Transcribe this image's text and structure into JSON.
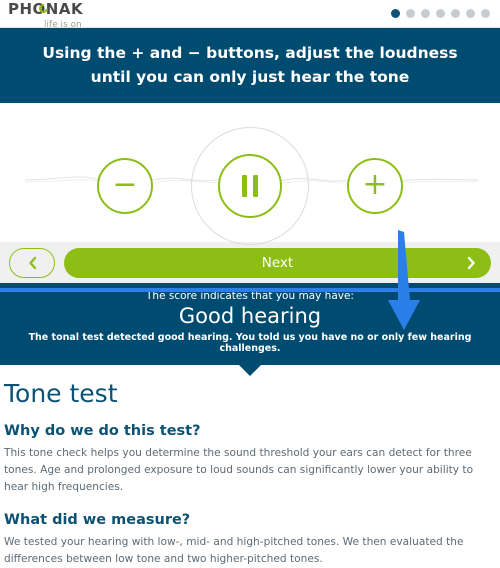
{
  "brand": {
    "name": "PHONAK",
    "tagline": "life is on",
    "logo_icon": "phonak-swoosh-icon",
    "accent_green": "#8CBE16",
    "accent_blue": "#004B70"
  },
  "progress": {
    "total_steps": 7,
    "active_step": 1,
    "dots": [
      true,
      false,
      false,
      false,
      false,
      false,
      false
    ]
  },
  "instruction": {
    "text": "Using the + and − buttons, adjust the loudness until you can only just hear the tone"
  },
  "player": {
    "decrease_label": "−",
    "decrease_icon": "minus-icon",
    "increase_label": "+",
    "increase_icon": "plus-icon",
    "play_state_icon": "pause-icon",
    "waveform_icon": "audio-waveform-icon"
  },
  "nav": {
    "back_icon": "chevron-left-icon",
    "next_label": "Next",
    "next_icon": "chevron-right-icon"
  },
  "results": {
    "score_label": "The score indicates that you may have:",
    "score_value": "Good hearing",
    "score_description": "The tonal test detected good hearing. You told us you have no or only few hearing challenges."
  },
  "article": {
    "title": "Tone test",
    "sections": [
      {
        "heading": "Why do we do this test?",
        "body": "This tone check helps you determine the sound threshold your ears can detect for three tones. Age and prolonged exposure to loud sounds can significantly lower your ability to hear high frequencies."
      },
      {
        "heading": "What did we measure?",
        "body": "We tested your hearing with low-, mid- and high-pitched tones. We then evaluated the differences between low tone and two higher-pitched tones."
      }
    ]
  },
  "annotation": {
    "arrow_icon": "down-arrow-annotation-icon",
    "line_icon": "horizontal-line-annotation-icon",
    "color": "#2b7fe8"
  }
}
